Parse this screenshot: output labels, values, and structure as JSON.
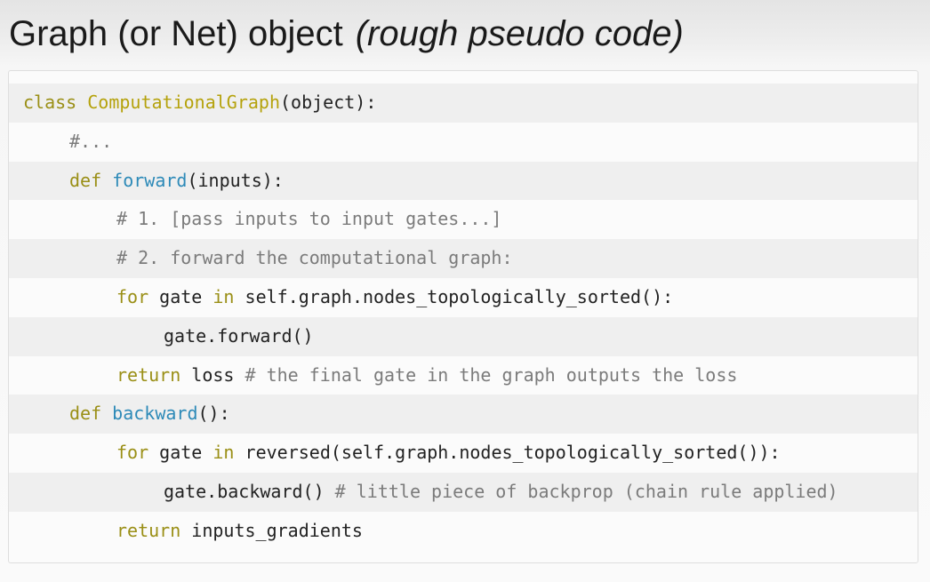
{
  "title": {
    "main": "Graph (or Net) object",
    "note": "(rough pseudo code)"
  },
  "colors": {
    "keyword": "#9a8f16",
    "class_name": "#b5a20c",
    "function_name": "#2d8ab8",
    "comment": "#7b7b7b",
    "text": "#222222"
  },
  "code": {
    "line1": {
      "kw": "class",
      "cls": "ComputationalGraph",
      "rest": "(object):"
    },
    "line2": {
      "cm": "#..."
    },
    "line3": {
      "kw": "def",
      "fn": "forward",
      "rest": "(inputs):"
    },
    "line4": {
      "cm": "# 1. [pass inputs to input gates...]"
    },
    "line5": {
      "cm": "# 2. forward the computational graph:"
    },
    "line6": {
      "kw1": "for",
      "t1": "gate",
      "kw2": "in",
      "rest": "self.graph.nodes_topologically_sorted():"
    },
    "line7": {
      "text": "gate.forward()"
    },
    "line8": {
      "kw": "return",
      "text": "loss",
      "cm": "# the final gate in the graph outputs the loss"
    },
    "line9": {
      "kw": "def",
      "fn": "backward",
      "rest": "():"
    },
    "line10": {
      "kw1": "for",
      "t1": "gate",
      "kw2": "in",
      "rest": "reversed(self.graph.nodes_topologically_sorted()):"
    },
    "line11": {
      "text": "gate.backward()",
      "cm": "# little piece of backprop (chain rule applied)"
    },
    "line12": {
      "kw": "return",
      "text": "inputs_gradients"
    }
  }
}
